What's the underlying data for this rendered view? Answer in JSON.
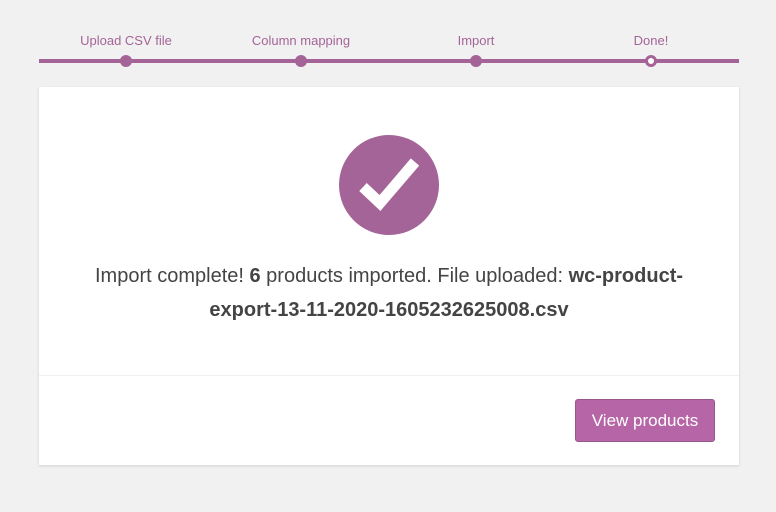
{
  "steps": [
    {
      "label": "Upload CSV file",
      "state": "done"
    },
    {
      "label": "Column mapping",
      "state": "done"
    },
    {
      "label": "Import",
      "state": "done"
    },
    {
      "label": "Done!",
      "state": "current"
    }
  ],
  "result": {
    "prefix": "Import complete! ",
    "count": "6",
    "middle": " products imported. File uploaded: ",
    "filename": "wc-product-export-13-11-2020-1605232625008.csv"
  },
  "actions": {
    "view_products_label": "View products"
  },
  "icons": {
    "status": "checkmark-circle-icon"
  },
  "colors": {
    "accent": "#a46497",
    "button": "#b666a7",
    "background": "#f1f1f1",
    "text": "#444444"
  }
}
